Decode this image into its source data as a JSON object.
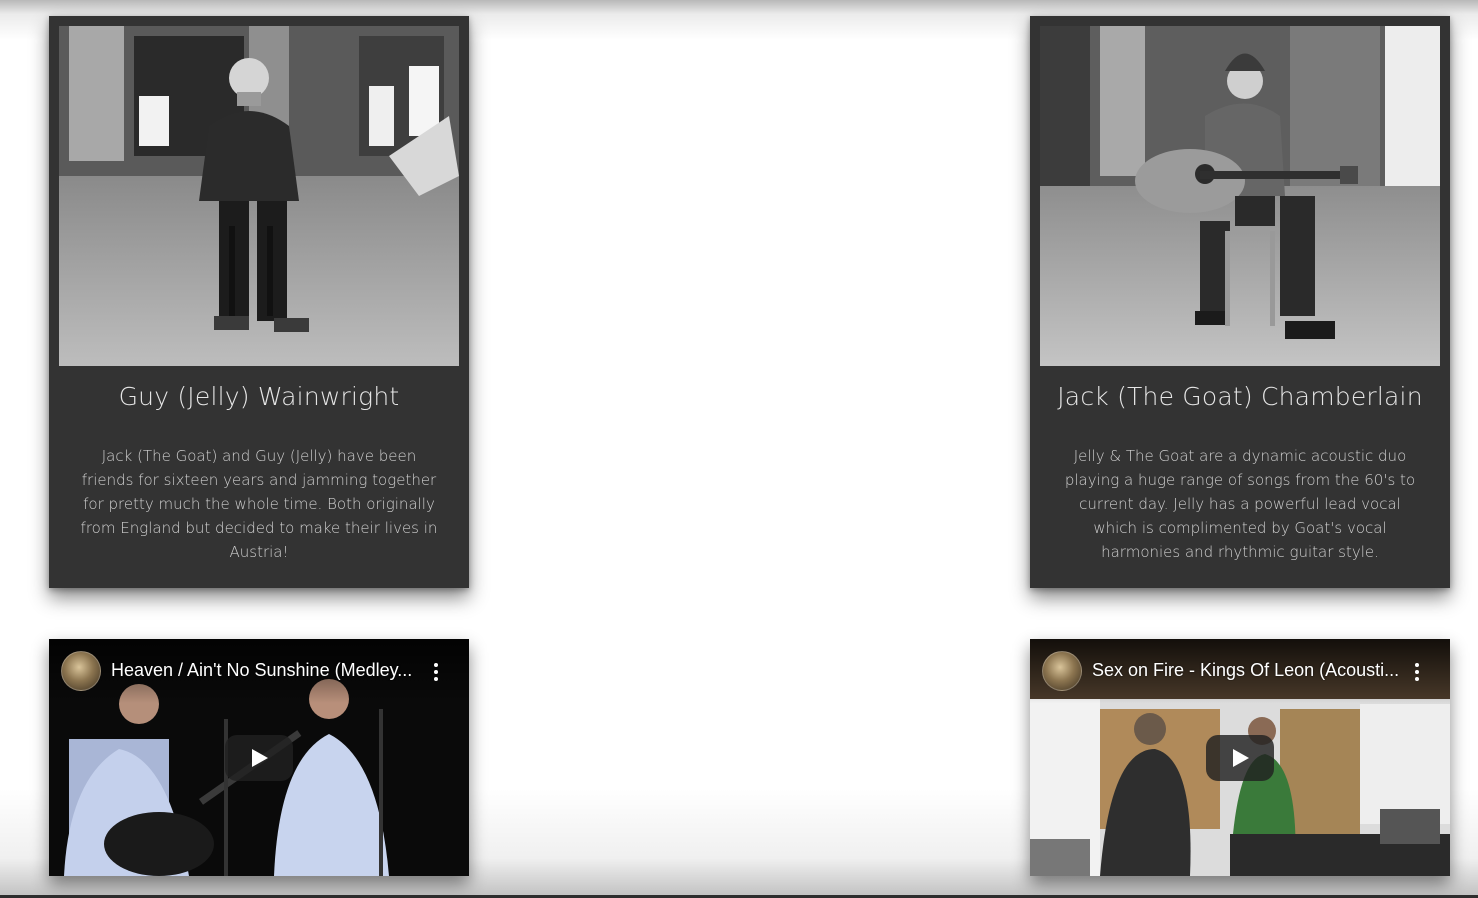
{
  "cards": [
    {
      "title": "Guy (Jelly) Wainwright",
      "body": "Jack (The Goat) and Guy (Jelly) have been friends for sixteen years and jamming together for pretty much the whole time. Both originally from England but decided to make their lives in Austria!"
    },
    {
      "title": "Jack (The Goat) Chamberlain",
      "body": "Jelly & The Goat are a dynamic acoustic duo playing a huge range of songs from the 60's to current day. Jelly has a powerful lead vocal which is complimented by Goat's vocal harmonies and rhythmic guitar style."
    }
  ],
  "videos": [
    {
      "title": "Heaven / Ain't No Sunshine (Medley..."
    },
    {
      "title": "Sex on Fire - Kings Of Leon (Acousti..."
    }
  ],
  "icons": {
    "play": "play-icon",
    "more": "more-vert-icon",
    "avatar": "channel-avatar"
  },
  "colors": {
    "card_background": "#333333",
    "card_title": "#e6e6e6",
    "card_text": "#cfcfcf"
  }
}
